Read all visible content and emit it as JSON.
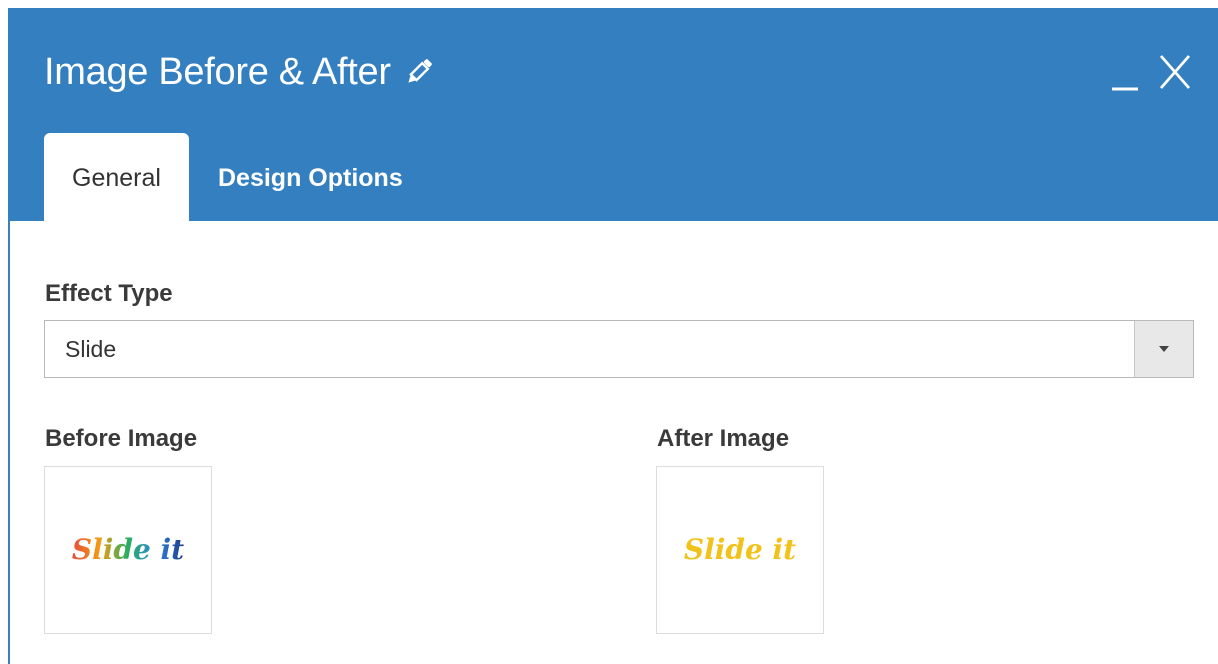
{
  "dialog": {
    "title": "Image Before & After"
  },
  "tabs": [
    {
      "label": "General",
      "active": true
    },
    {
      "label": "Design Options",
      "active": false
    }
  ],
  "effect_type": {
    "label": "Effect Type",
    "selected": "Slide"
  },
  "before_image": {
    "label": "Before Image",
    "logo_text": "Slide it"
  },
  "after_image": {
    "label": "After Image",
    "logo_text": "Slide it"
  },
  "colors": {
    "header": "#337fc0",
    "after_logo": "#f2c21b",
    "before_logo_gradient": [
      "#e84c3d",
      "#f39c12",
      "#27ae60",
      "#2e86de",
      "#1e3a8a"
    ]
  },
  "icons": [
    "pencil-icon",
    "minimize-icon",
    "close-icon",
    "chevron-down-icon"
  ]
}
